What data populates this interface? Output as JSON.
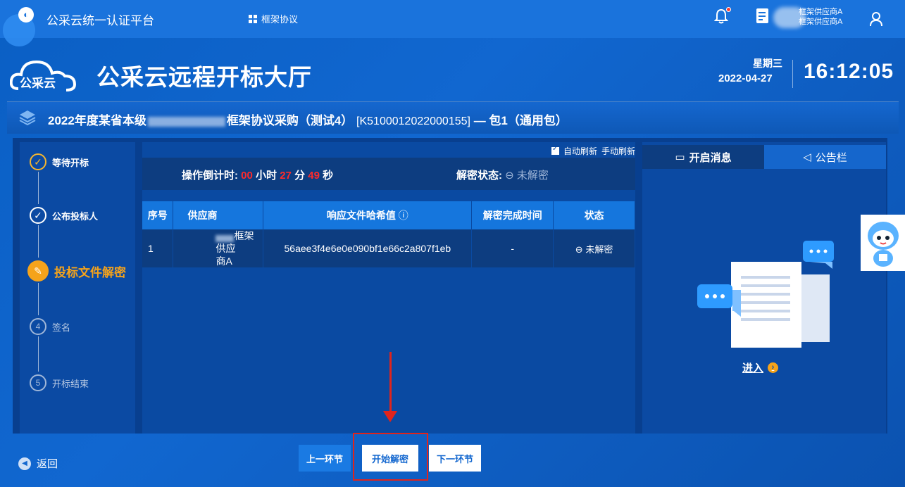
{
  "topbar": {
    "platform_name": "公采云统一认证平台",
    "nav_item": "框架协议",
    "user_line1": "框架供应商A",
    "user_line2": "框架供应商A"
  },
  "hall": {
    "title": "公采云远程开标大厅",
    "logo_text": "公采云",
    "weekday": "星期三",
    "date": "2022-04-27",
    "time": "16:12:05"
  },
  "project": {
    "title_prefix": "2022年度某省本级",
    "title_suffix": "框架协议采购（测试4）",
    "code": "[K5100012022000155]",
    "package": "— 包1（通用包）"
  },
  "steps": [
    {
      "num": "✓",
      "label": "等待开标",
      "state": "done"
    },
    {
      "num": "✓",
      "label": "公布投标人",
      "state": "done"
    },
    {
      "num": "✎",
      "label": "投标文件解密",
      "state": "current"
    },
    {
      "num": "4",
      "label": "签名",
      "state": "pending"
    },
    {
      "num": "5",
      "label": "开标结束",
      "state": "pending"
    }
  ],
  "refresh": {
    "auto_label": "自动刷新",
    "manual_label": "手动刷新"
  },
  "countdown": {
    "label": "操作倒计时:",
    "hours": "00",
    "hours_unit": "小时",
    "minutes": "27",
    "minutes_unit": "分",
    "seconds": "49",
    "seconds_unit": "秒",
    "status_label": "解密状态:",
    "status_value": "未解密"
  },
  "table": {
    "headers": [
      "序号",
      "供应商",
      "响应文件哈希值",
      "解密完成时间",
      "状态"
    ],
    "rows": [
      {
        "index": "1",
        "supplier_a": "框架供应",
        "supplier_b": "商A",
        "hash": "56aee3f4e6e0e090bf1e66c2a807f1eb",
        "time": "-",
        "status": "未解密"
      }
    ]
  },
  "right_panel": {
    "tab_active": "开启消息",
    "tab_inactive": "公告栏",
    "enter_label": "进入"
  },
  "footer": {
    "back": "返回",
    "prev": "上一环节",
    "start": "开始解密",
    "next": "下一环节"
  },
  "colors": {
    "background": "#0a5fc4",
    "accent_orange": "#f5a31b",
    "countdown_red": "#ff2a2a",
    "highlight_red": "#e0241c"
  }
}
